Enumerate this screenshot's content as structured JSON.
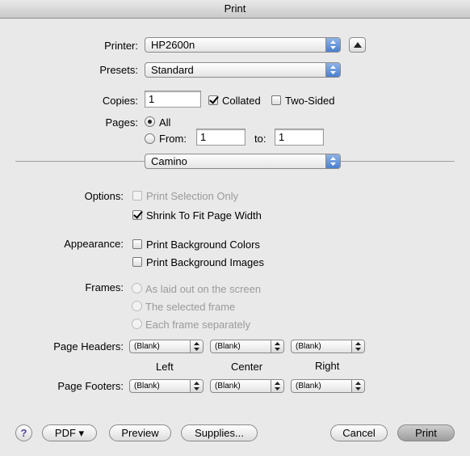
{
  "window": {
    "title": "Print"
  },
  "printer": {
    "label": "Printer:",
    "value": "HP2600n"
  },
  "presets": {
    "label": "Presets:",
    "value": "Standard"
  },
  "copies": {
    "label": "Copies:",
    "value": "1",
    "collated_label": "Collated",
    "collated": true,
    "two_sided_label": "Two-Sided",
    "two_sided": false
  },
  "pages": {
    "label": "Pages:",
    "all_label": "All",
    "from_label": "From:",
    "from_value": "1",
    "to_label": "to:",
    "to_value": "1",
    "selected": "All"
  },
  "panel": {
    "value": "Camino"
  },
  "options": {
    "label": "Options:",
    "print_selection_label": "Print Selection Only",
    "shrink_label": "Shrink To Fit Page Width",
    "shrink_checked": true
  },
  "appearance": {
    "label": "Appearance:",
    "bg_colors_label": "Print Background Colors",
    "bg_images_label": "Print Background Images"
  },
  "frames": {
    "label": "Frames:",
    "opt1": "As laid out on the screen",
    "opt2": "The selected frame",
    "opt3": "Each frame separately"
  },
  "headers": {
    "label": "Page Headers:",
    "left": "(Blank)",
    "center": "(Blank)",
    "right": "(Blank)"
  },
  "columns": {
    "left": "Left",
    "center": "Center",
    "right": "Right"
  },
  "footers": {
    "label": "Page Footers:",
    "left": "(Blank)",
    "center": "(Blank)",
    "right": "(Blank)"
  },
  "buttons": {
    "help": "?",
    "pdf": "PDF ▾",
    "preview": "Preview",
    "supplies": "Supplies...",
    "cancel": "Cancel",
    "print": "Print"
  },
  "colors": {
    "accent": "#4a7fd0"
  }
}
